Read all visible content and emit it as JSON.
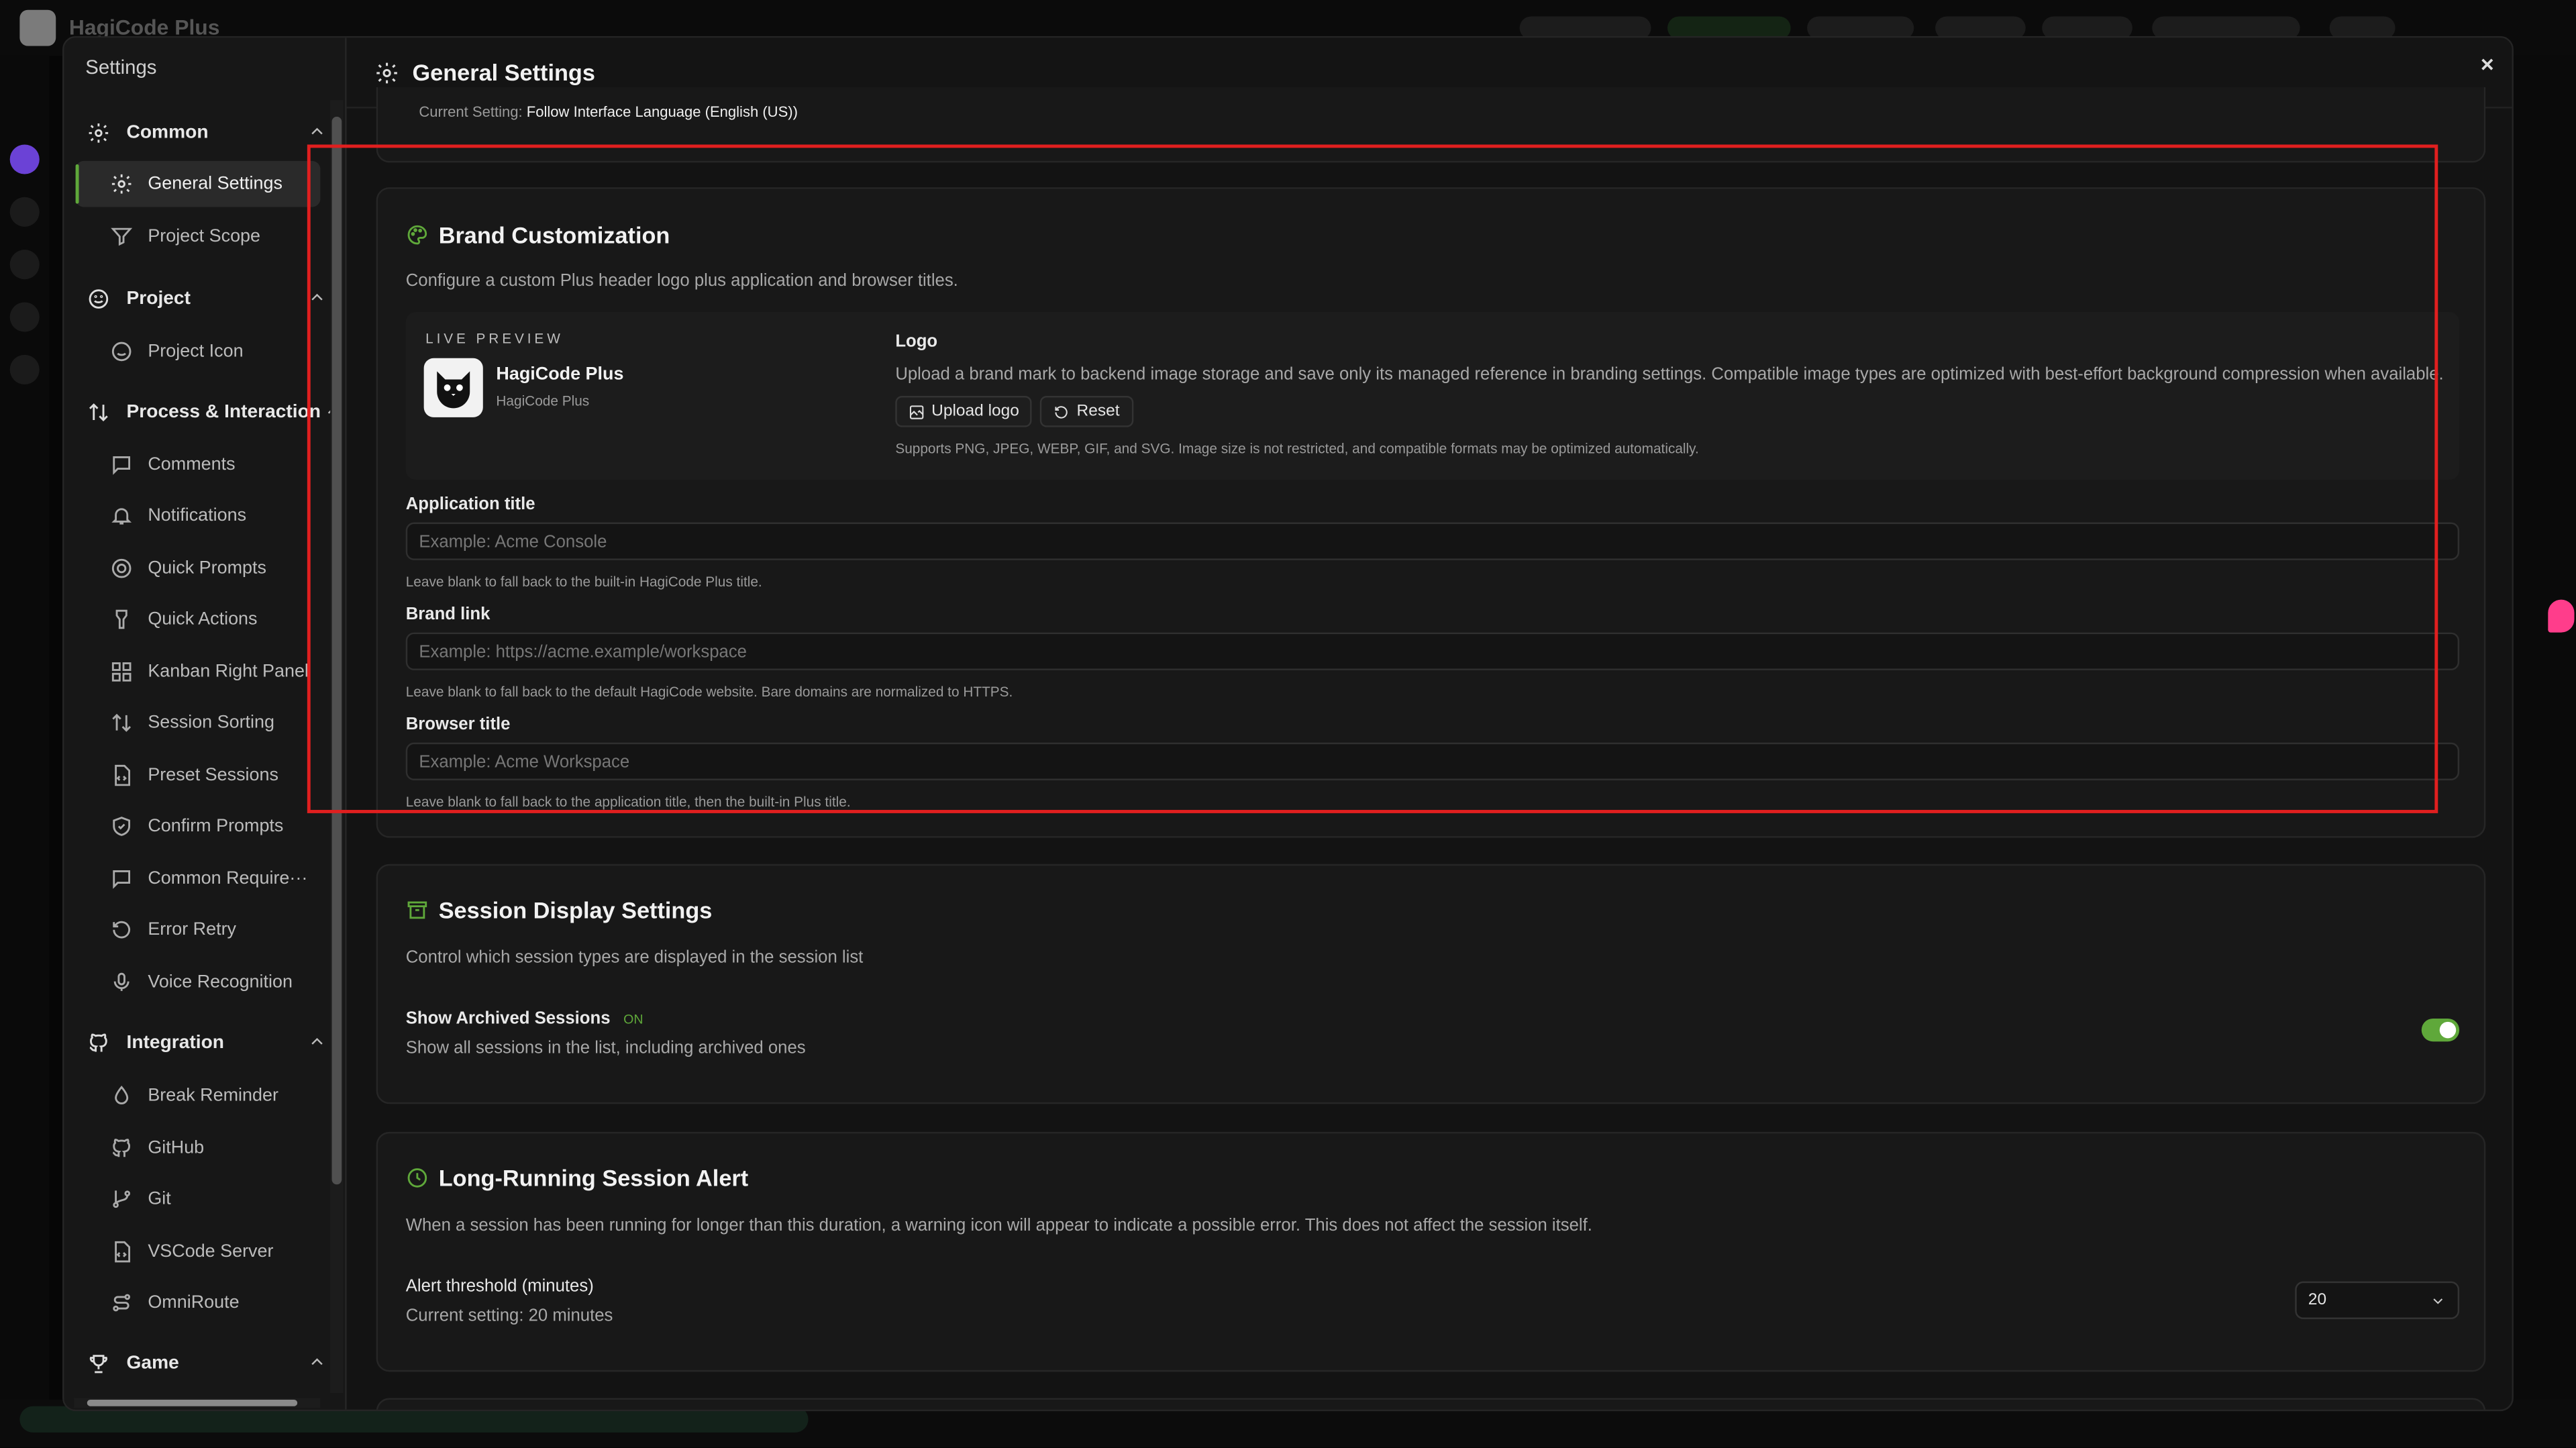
{
  "app": {
    "title": "HagiCode Plus"
  },
  "settings": {
    "window_title": "Settings",
    "page_title": "General Settings",
    "close_label": "×",
    "sidebar": {
      "groups": [
        {
          "label": "Common",
          "items": [
            {
              "label": "General Settings",
              "active": true
            },
            {
              "label": "Project Scope"
            }
          ]
        },
        {
          "label": "Project",
          "items": [
            {
              "label": "Project Icon"
            }
          ]
        },
        {
          "label": "Process & Interaction",
          "items": [
            {
              "label": "Comments"
            },
            {
              "label": "Notifications"
            },
            {
              "label": "Quick Prompts"
            },
            {
              "label": "Quick Actions"
            },
            {
              "label": "Kanban Right Panel"
            },
            {
              "label": "Session Sorting"
            },
            {
              "label": "Preset Sessions"
            },
            {
              "label": "Confirm Prompts"
            },
            {
              "label": "Common Require···"
            },
            {
              "label": "Error Retry"
            },
            {
              "label": "Voice Recognition"
            }
          ]
        },
        {
          "label": "Integration",
          "items": [
            {
              "label": "Break Reminder"
            },
            {
              "label": "GitHub"
            },
            {
              "label": "Git"
            },
            {
              "label": "VSCode Server"
            },
            {
              "label": "OmniRoute"
            }
          ]
        },
        {
          "label": "Game",
          "items": []
        }
      ]
    },
    "language_card": {
      "current_prefix": "Current Setting:",
      "current_value": "Follow Interface Language (English (US))"
    },
    "brand": {
      "title": "Brand Customization",
      "description": "Configure a custom Plus header logo plus application and browser titles.",
      "preview_label": "LIVE PREVIEW",
      "preview_name": "HagiCode Plus",
      "preview_sub": "HagiCode Plus",
      "logo_label": "Logo",
      "logo_desc": "Upload a brand mark to backend image storage and save only its managed reference in branding settings. Compatible image types are optimized with best-effort background compression when available.",
      "upload_label": "Upload logo",
      "reset_label": "Reset",
      "logo_hint": "Supports PNG, JPEG, WEBP, GIF, and SVG. Image size is not restricted, and compatible formats may be optimized automatically.",
      "app_title_label": "Application title",
      "app_title_placeholder": "Example: Acme Console",
      "app_title_hint": "Leave blank to fall back to the built-in HagiCode Plus title.",
      "brand_link_label": "Brand link",
      "brand_link_placeholder": "Example: https://acme.example/workspace",
      "brand_link_hint": "Leave blank to fall back to the default HagiCode website. Bare domains are normalized to HTTPS.",
      "browser_title_label": "Browser title",
      "browser_title_placeholder": "Example: Acme Workspace",
      "browser_title_hint": "Leave blank to fall back to the application title, then the built-in Plus title."
    },
    "session_display": {
      "title": "Session Display Settings",
      "description": "Control which session types are displayed in the session list",
      "option_label": "Show Archived Sessions",
      "option_state": "ON",
      "option_desc": "Show all sessions in the list, including archived ones",
      "toggle_on": true
    },
    "long_running": {
      "title": "Long-Running Session Alert",
      "description": "When a session has been running for longer than this duration, a warning icon will appear to indicate a possible error. This does not affect the session itself.",
      "threshold_label": "Alert threshold (minutes)",
      "current_label": "Current setting: 20 minutes",
      "threshold_value": "20"
    }
  },
  "colors": {
    "accent": "#5fa83a",
    "highlight": "#e01f1f",
    "toggle": "#5fa83a"
  }
}
